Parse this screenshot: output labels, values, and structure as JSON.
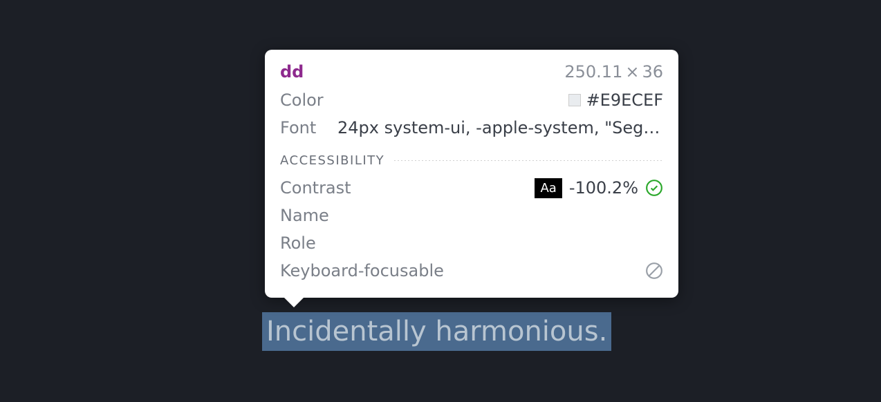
{
  "highlighted": {
    "text": "Incidentally harmonious."
  },
  "tooltip": {
    "tag": "dd",
    "width": "250.11",
    "height": "36",
    "color": {
      "label": "Color",
      "value": "#E9ECEF"
    },
    "font": {
      "label": "Font",
      "value": "24px system-ui, -apple-system, \"Segoe…"
    },
    "accessibility": {
      "title": "ACCESSIBILITY",
      "contrast": {
        "label": "Contrast",
        "badge": "Aa",
        "value": "-100.2%"
      },
      "name": {
        "label": "Name",
        "value": ""
      },
      "role": {
        "label": "Role",
        "value": ""
      },
      "keyboard": {
        "label": "Keyboard-focusable"
      }
    }
  }
}
